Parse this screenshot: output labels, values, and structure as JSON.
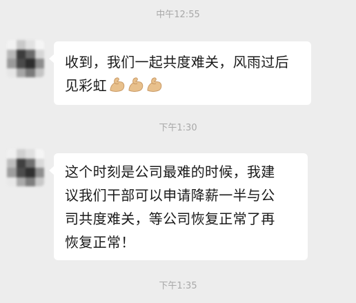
{
  "chat": {
    "timestamps": [
      "中午12:55",
      "下午1:30",
      "下午1:35"
    ],
    "messages": [
      {
        "lines": [
          "收到，我们一起共度难关，风雨过后",
          "见彩虹"
        ],
        "emoji": [
          "flexed-biceps-icon",
          "flexed-biceps-icon",
          "flexed-biceps-icon"
        ]
      },
      {
        "lines": [
          "这个时刻是公司最难的时候，我建",
          "议我们干部可以申请降薪一半与公",
          "司共度难关，等公司恢复正常了再",
          "恢复正常！"
        ]
      }
    ]
  },
  "colors": {
    "background": "#ededed",
    "bubble": "#ffffff",
    "text": "#1a1a1a",
    "timestamp": "#a8a8a8",
    "emoji": "#e8c08c"
  }
}
